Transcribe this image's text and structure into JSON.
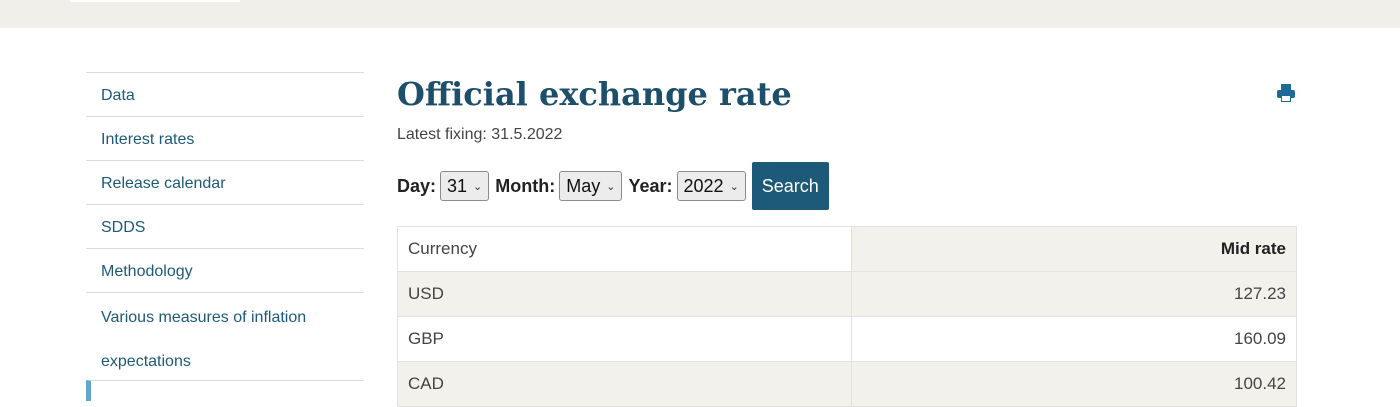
{
  "sidebar": {
    "items": [
      {
        "label": "Data"
      },
      {
        "label": "Interest rates"
      },
      {
        "label": "Release calendar"
      },
      {
        "label": "SDDS"
      },
      {
        "label": "Methodology"
      },
      {
        "label": "Various measures of inflation expectations"
      }
    ]
  },
  "main": {
    "title": "Official exchange rate",
    "latest_fixing": "Latest fixing: 31.5.2022",
    "controls": {
      "day_label": "Day:",
      "day_value": "31",
      "month_label": "Month:",
      "month_value": "May",
      "year_label": "Year:",
      "year_value": "2022",
      "search_label": "Search"
    },
    "table": {
      "headers": [
        "Currency",
        "Mid rate"
      ],
      "rows": [
        {
          "currency": "USD",
          "rate": "127.23"
        },
        {
          "currency": "GBP",
          "rate": "160.09"
        },
        {
          "currency": "CAD",
          "rate": "100.42"
        }
      ]
    }
  },
  "icons": {
    "print": "print-icon",
    "chevron": "chevron-down-icon"
  },
  "colors": {
    "accent": "#1d5a7a",
    "title": "#1d4f6b",
    "active_marker": "#5fa8cc",
    "row_alt": "#f3f1ec"
  }
}
